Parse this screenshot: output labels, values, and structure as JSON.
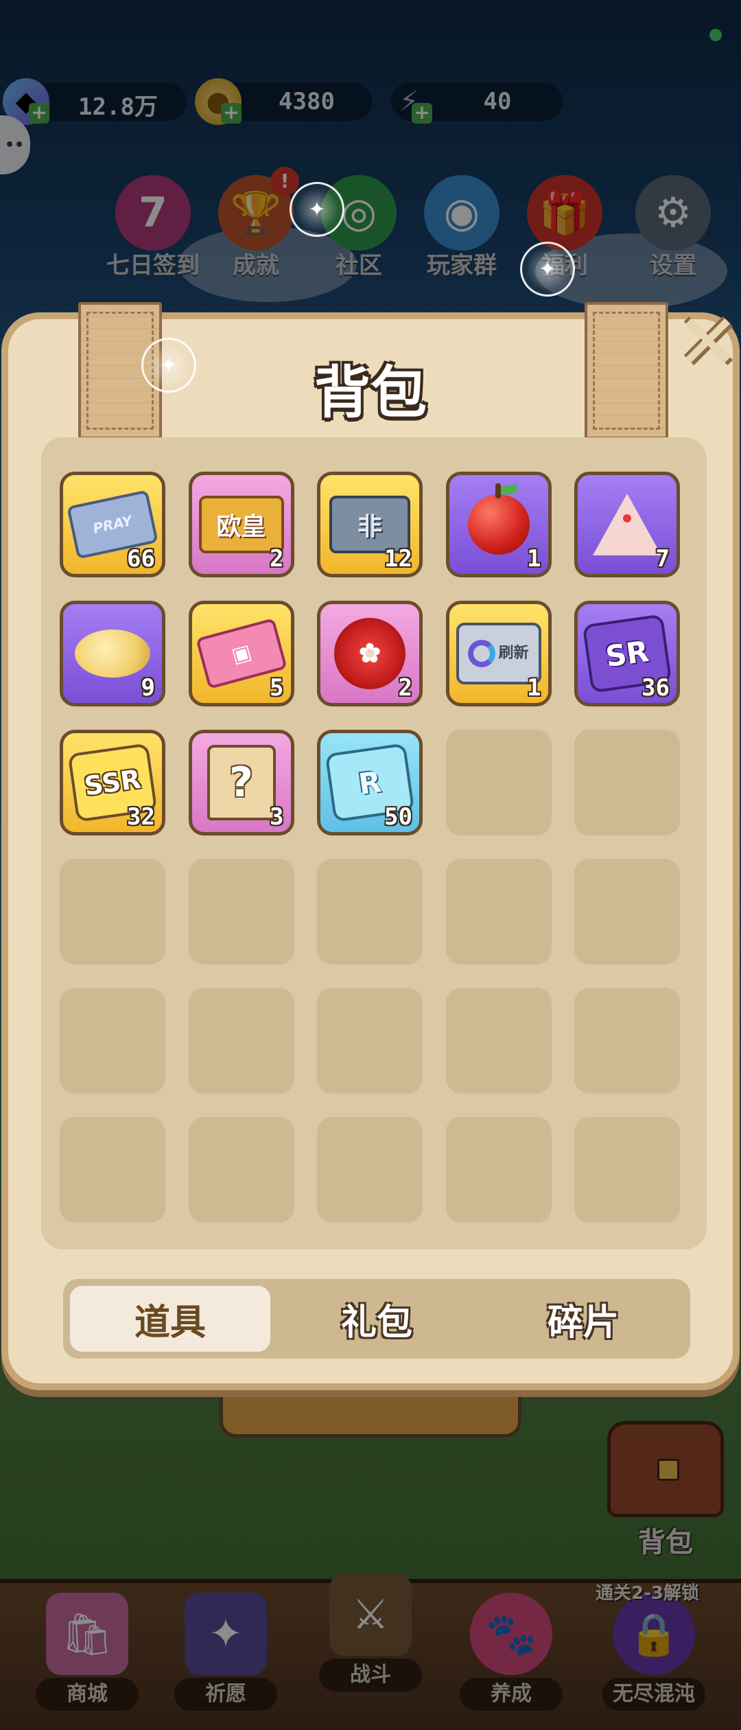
{
  "status": {
    "indicator_color": "#47d36a"
  },
  "resources": [
    {
      "icon": "gem-icon",
      "value": "12.8万"
    },
    {
      "icon": "coin-icon",
      "value": "4380"
    },
    {
      "icon": "energy-icon",
      "value": "40"
    }
  ],
  "top_menu": [
    {
      "icon": "seven-day-icon",
      "label": "七日签到",
      "glyph": "7"
    },
    {
      "icon": "trophy-icon",
      "label": "成就",
      "badge": "!"
    },
    {
      "icon": "community-icon",
      "label": "社区"
    },
    {
      "icon": "qq-icon",
      "label": "玩家群"
    },
    {
      "icon": "gift-icon",
      "label": "福利"
    },
    {
      "icon": "gear-icon",
      "label": "设置"
    }
  ],
  "panel": {
    "title": "背包",
    "items": [
      {
        "name": "pray-ticket",
        "icon": "pray-ticket-icon",
        "text": "PRAY",
        "count": "66",
        "frame": "gold"
      },
      {
        "name": "ouhuang-card",
        "icon": "ouhuang-card-icon",
        "text": "欧皇",
        "count": "2",
        "frame": "pink"
      },
      {
        "name": "fei-card",
        "icon": "fei-card-icon",
        "text": "非",
        "count": "12",
        "frame": "gold"
      },
      {
        "name": "apple",
        "icon": "apple-icon",
        "count": "1",
        "frame": "purple"
      },
      {
        "name": "cake",
        "icon": "cake-icon",
        "count": "7",
        "frame": "purple"
      },
      {
        "name": "chips",
        "icon": "chips-icon",
        "count": "9",
        "frame": "purple"
      },
      {
        "name": "pink-ticket",
        "icon": "pink-ticket-icon",
        "count": "5",
        "frame": "gold"
      },
      {
        "name": "plum-blossom",
        "icon": "plum-blossom-icon",
        "count": "2",
        "frame": "pink"
      },
      {
        "name": "refresh-card",
        "icon": "refresh-card-icon",
        "text": "刷新",
        "count": "1",
        "frame": "gold"
      },
      {
        "name": "sr-fragment",
        "icon": "sr-fragment-icon",
        "text": "SR",
        "count": "36",
        "frame": "purple"
      },
      {
        "name": "ssr-fragment",
        "icon": "ssr-fragment-icon",
        "text": "SSR",
        "count": "32",
        "frame": "gold"
      },
      {
        "name": "mystery-bag",
        "icon": "mystery-bag-icon",
        "text": "?",
        "count": "3",
        "frame": "pink"
      },
      {
        "name": "r-fragment",
        "icon": "r-fragment-icon",
        "text": "R",
        "count": "50",
        "frame": "blue"
      }
    ],
    "tabs": [
      {
        "label": "道具",
        "active": true
      },
      {
        "label": "礼包",
        "active": false
      },
      {
        "label": "碎片",
        "active": false
      }
    ]
  },
  "bag_button": {
    "label": "背包"
  },
  "unlock_note": "通关2-3解锁",
  "bottom_nav": [
    {
      "icon": "shop-icon",
      "label": "商城"
    },
    {
      "icon": "wish-icon",
      "label": "祈愿"
    },
    {
      "icon": "battle-icon",
      "label": "战斗",
      "active": true
    },
    {
      "icon": "paw-icon",
      "label": "养成"
    },
    {
      "icon": "lock-icon",
      "label": "无尽混沌"
    }
  ]
}
